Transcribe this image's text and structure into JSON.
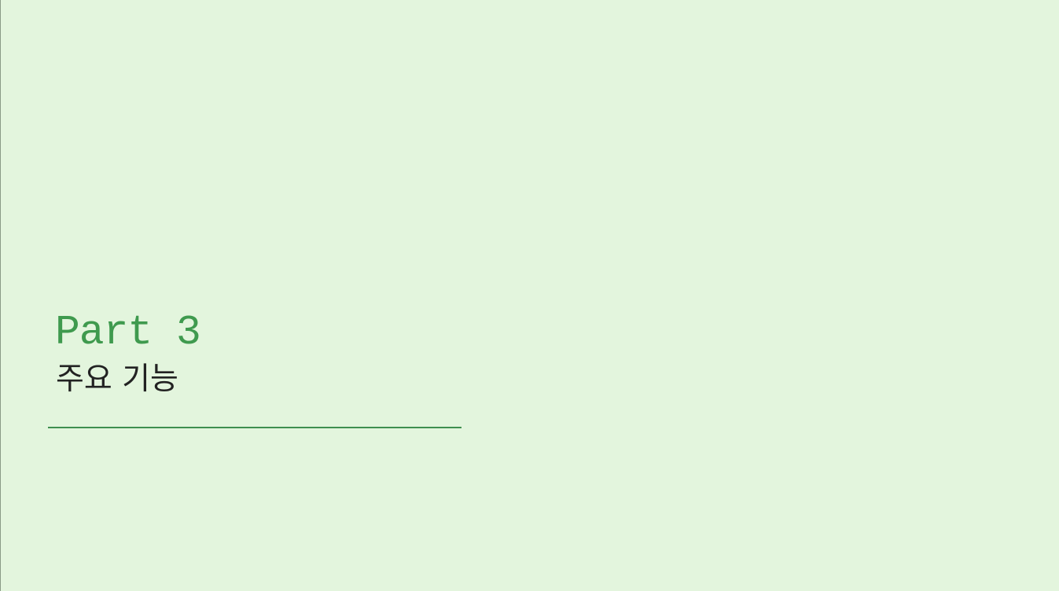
{
  "slide": {
    "part_label": "Part 3",
    "section_title": "주요 기능"
  },
  "colors": {
    "background": "#e3f5dd",
    "accent": "#3f9a4e",
    "divider": "#3f8f4f",
    "text": "#222222"
  }
}
